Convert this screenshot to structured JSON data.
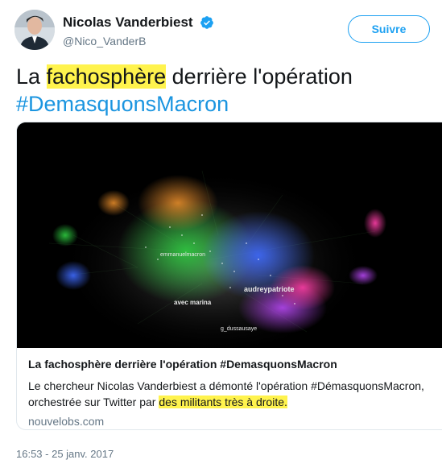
{
  "user": {
    "display_name": "Nicolas Vanderbiest",
    "handle": "@Nico_VanderB",
    "verified": true
  },
  "follow_button": {
    "label": "Suivre"
  },
  "tweet": {
    "text_prefix": "La ",
    "text_highlight": "fachosphère",
    "text_suffix": " derrière l'opération",
    "hashtag": "#DemasquonsMacron",
    "timestamp": "16:53 - 25 janv. 2017"
  },
  "card": {
    "title": "La fachosphère derrière l'opération #DemasquonsMacron",
    "description_prefix": "Le chercheur Nicolas Vanderbiest a démonté l'opération #DémasquonsMacron, orchestrée sur Twitter par ",
    "description_highlight": "des militants très à droite.",
    "domain": "nouvelobs.com",
    "image_labels": [
      "emmanuelmacron",
      "audreypatriote",
      "avec marina",
      "g_dussausaye"
    ]
  },
  "colors": {
    "accent": "#1da1f2",
    "hashtag": "#1b95e0",
    "highlight": "#fff34d",
    "muted": "#657786"
  },
  "icons": [
    "verified-badge-icon",
    "avatar"
  ]
}
